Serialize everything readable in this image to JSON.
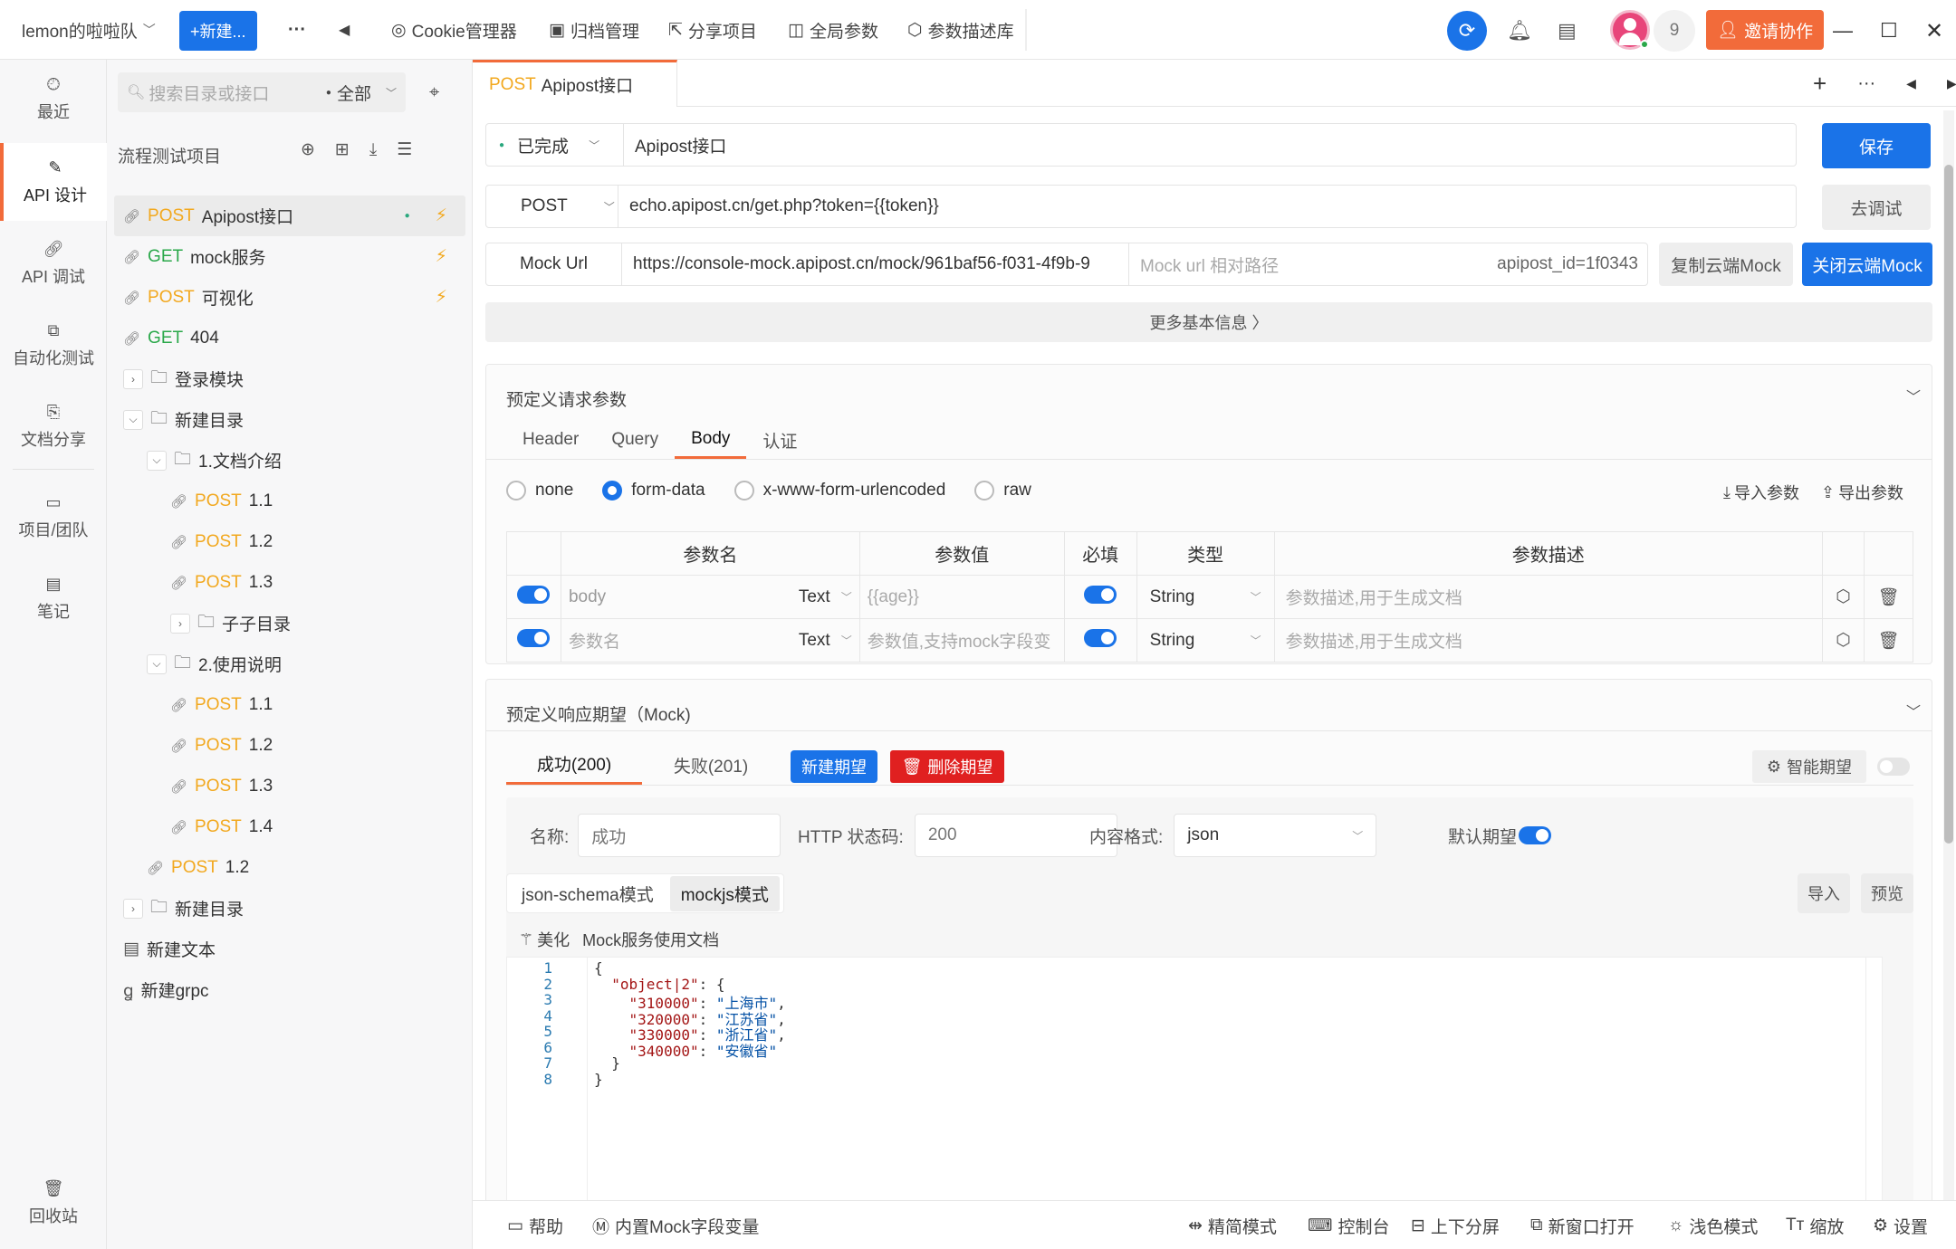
{
  "topbar": {
    "team": "lemon的啦啦队",
    "new_btn": "+新建...",
    "more": "···",
    "back": "◀",
    "tabs": [
      {
        "icon": "cookie-icon",
        "label": "Cookie管理器"
      },
      {
        "icon": "archive-icon",
        "label": "归档管理"
      },
      {
        "icon": "share-icon",
        "label": "分享项目"
      },
      {
        "icon": "globals-icon",
        "label": "全局参数"
      },
      {
        "icon": "param-lib-icon",
        "label": "参数描述库"
      }
    ],
    "user_count": "9",
    "invite": "邀请协作"
  },
  "leftnav": [
    {
      "label": "最近",
      "icon": "clock-icon"
    },
    {
      "label": "API 设计",
      "icon": "edit-icon",
      "active": true
    },
    {
      "label": "API 调试",
      "icon": "link-icon"
    },
    {
      "label": "自动化测试",
      "icon": "flow-icon"
    },
    {
      "label": "文档分享",
      "icon": "doc-icon"
    },
    {
      "label": "项目/团队",
      "icon": "folder-icon"
    },
    {
      "label": "笔记",
      "icon": "note-icon"
    },
    {
      "label": "回收站",
      "icon": "trash-icon"
    }
  ],
  "tree": {
    "search_placeholder": "搜索目录或接口",
    "filter": "全部",
    "project": "流程测试项目",
    "rows": [
      {
        "type": "api",
        "method": "POST",
        "name": "Apipost接口",
        "indent": 0,
        "sel": true
      },
      {
        "type": "api",
        "method": "GET",
        "name": "mock服务",
        "indent": 0
      },
      {
        "type": "api",
        "method": "POST",
        "name": "可视化",
        "indent": 0
      },
      {
        "type": "api",
        "method": "GET",
        "name": "404",
        "indent": 0
      },
      {
        "type": "folder",
        "name": "登录模块",
        "indent": 0,
        "caret": ">"
      },
      {
        "type": "folder",
        "name": "新建目录",
        "indent": 0,
        "caret": "v"
      },
      {
        "type": "folder",
        "name": "1.文档介绍",
        "indent": 1,
        "caret": "v"
      },
      {
        "type": "api",
        "method": "POST",
        "name": "1.1",
        "indent": 2
      },
      {
        "type": "api",
        "method": "POST",
        "name": "1.2",
        "indent": 2
      },
      {
        "type": "api",
        "method": "POST",
        "name": "1.3",
        "indent": 2
      },
      {
        "type": "folder",
        "name": "子子目录",
        "indent": 2,
        "caret": ">"
      },
      {
        "type": "folder",
        "name": "2.使用说明",
        "indent": 1,
        "caret": "v"
      },
      {
        "type": "api",
        "method": "POST",
        "name": "1.1",
        "indent": 2
      },
      {
        "type": "api",
        "method": "POST",
        "name": "1.2",
        "indent": 2
      },
      {
        "type": "api",
        "method": "POST",
        "name": "1.3",
        "indent": 2
      },
      {
        "type": "api",
        "method": "POST",
        "name": "1.4",
        "indent": 2
      },
      {
        "type": "api",
        "method": "POST",
        "name": "1.2",
        "indent": 1
      },
      {
        "type": "folder",
        "name": "新建目录",
        "indent": 0,
        "caret": ">"
      },
      {
        "type": "doc",
        "name": "新建文本",
        "indent": 0
      },
      {
        "type": "grpc",
        "name": "新建grpc",
        "indent": 0
      }
    ]
  },
  "tab": {
    "method": "POST",
    "name": "Apipost接口"
  },
  "api": {
    "status": "已完成",
    "name": "Apipost接口",
    "save": "保存",
    "method": "POST",
    "url": "echo.apipost.cn/get.php?token={{token}}",
    "debug": "去调试",
    "mock_label": "Mock Url",
    "mock_url": "https://console-mock.apipost.cn/mock/961baf56-f031-4f9b-9",
    "mock_path_placeholder": "Mock url 相对路径",
    "mock_id": "apipost_id=1f0343",
    "copy_mock": "复制云端Mock",
    "close_mock": "关闭云端Mock",
    "more_info": "更多基本信息 〉"
  },
  "req": {
    "title": "预定义请求参数",
    "tabs": [
      "Header",
      "Query",
      "Body",
      "认证"
    ],
    "active_tab": "Body",
    "body_types": [
      "none",
      "form-data",
      "x-www-form-urlencoded",
      "raw"
    ],
    "import": "导入参数",
    "export": "导出参数",
    "headers": [
      "参数名",
      "参数值",
      "必填",
      "类型",
      "参数描述"
    ],
    "rows": [
      {
        "name": "body",
        "name_is_placeholder": false,
        "ftype": "Text",
        "value": "{{age}}",
        "type": "String",
        "desc": "参数描述,用于生成文档"
      },
      {
        "name": "参数名",
        "name_is_placeholder": true,
        "ftype": "Text",
        "value": "参数值,支持mock字段变",
        "type": "String",
        "desc": "参数描述,用于生成文档"
      }
    ]
  },
  "mock": {
    "title": "预定义响应期望（Mock)",
    "tab_success": "成功(200)",
    "tab_fail": "失败(201)",
    "new": "新建期望",
    "delete": "删除期望",
    "smart": "智能期望",
    "name_label": "名称:",
    "name_value": "成功",
    "status_label": "HTTP 状态码:",
    "status_value": "200",
    "format_label": "内容格式:",
    "format_value": "json",
    "default_label": "默认期望",
    "mode1": "json-schema模式",
    "mode2": "mockjs模式",
    "import": "导入",
    "preview": "预览",
    "beautify": "美化",
    "doc_link": "Mock服务使用文档",
    "code_lines": [
      "{",
      "  \"object|2\": {",
      "    \"310000\": \"上海市\",",
      "    \"320000\": \"江苏省\",",
      "    \"330000\": \"浙江省\",",
      "    \"340000\": \"安徽省\"",
      "  }",
      "}"
    ]
  },
  "bottom": {
    "help": "帮助",
    "mockvars": "内置Mock字段变量",
    "simple": "精简模式",
    "console": "控制台",
    "split": "上下分屏",
    "newwin": "新窗口打开",
    "light": "浅色模式",
    "zoom": "缩放",
    "settings": "设置"
  },
  "colors": {
    "accent": "#1a73e8",
    "brand": "#f26b3a",
    "post": "#f2a81e",
    "get": "#2aa84a",
    "danger": "#e02020"
  }
}
